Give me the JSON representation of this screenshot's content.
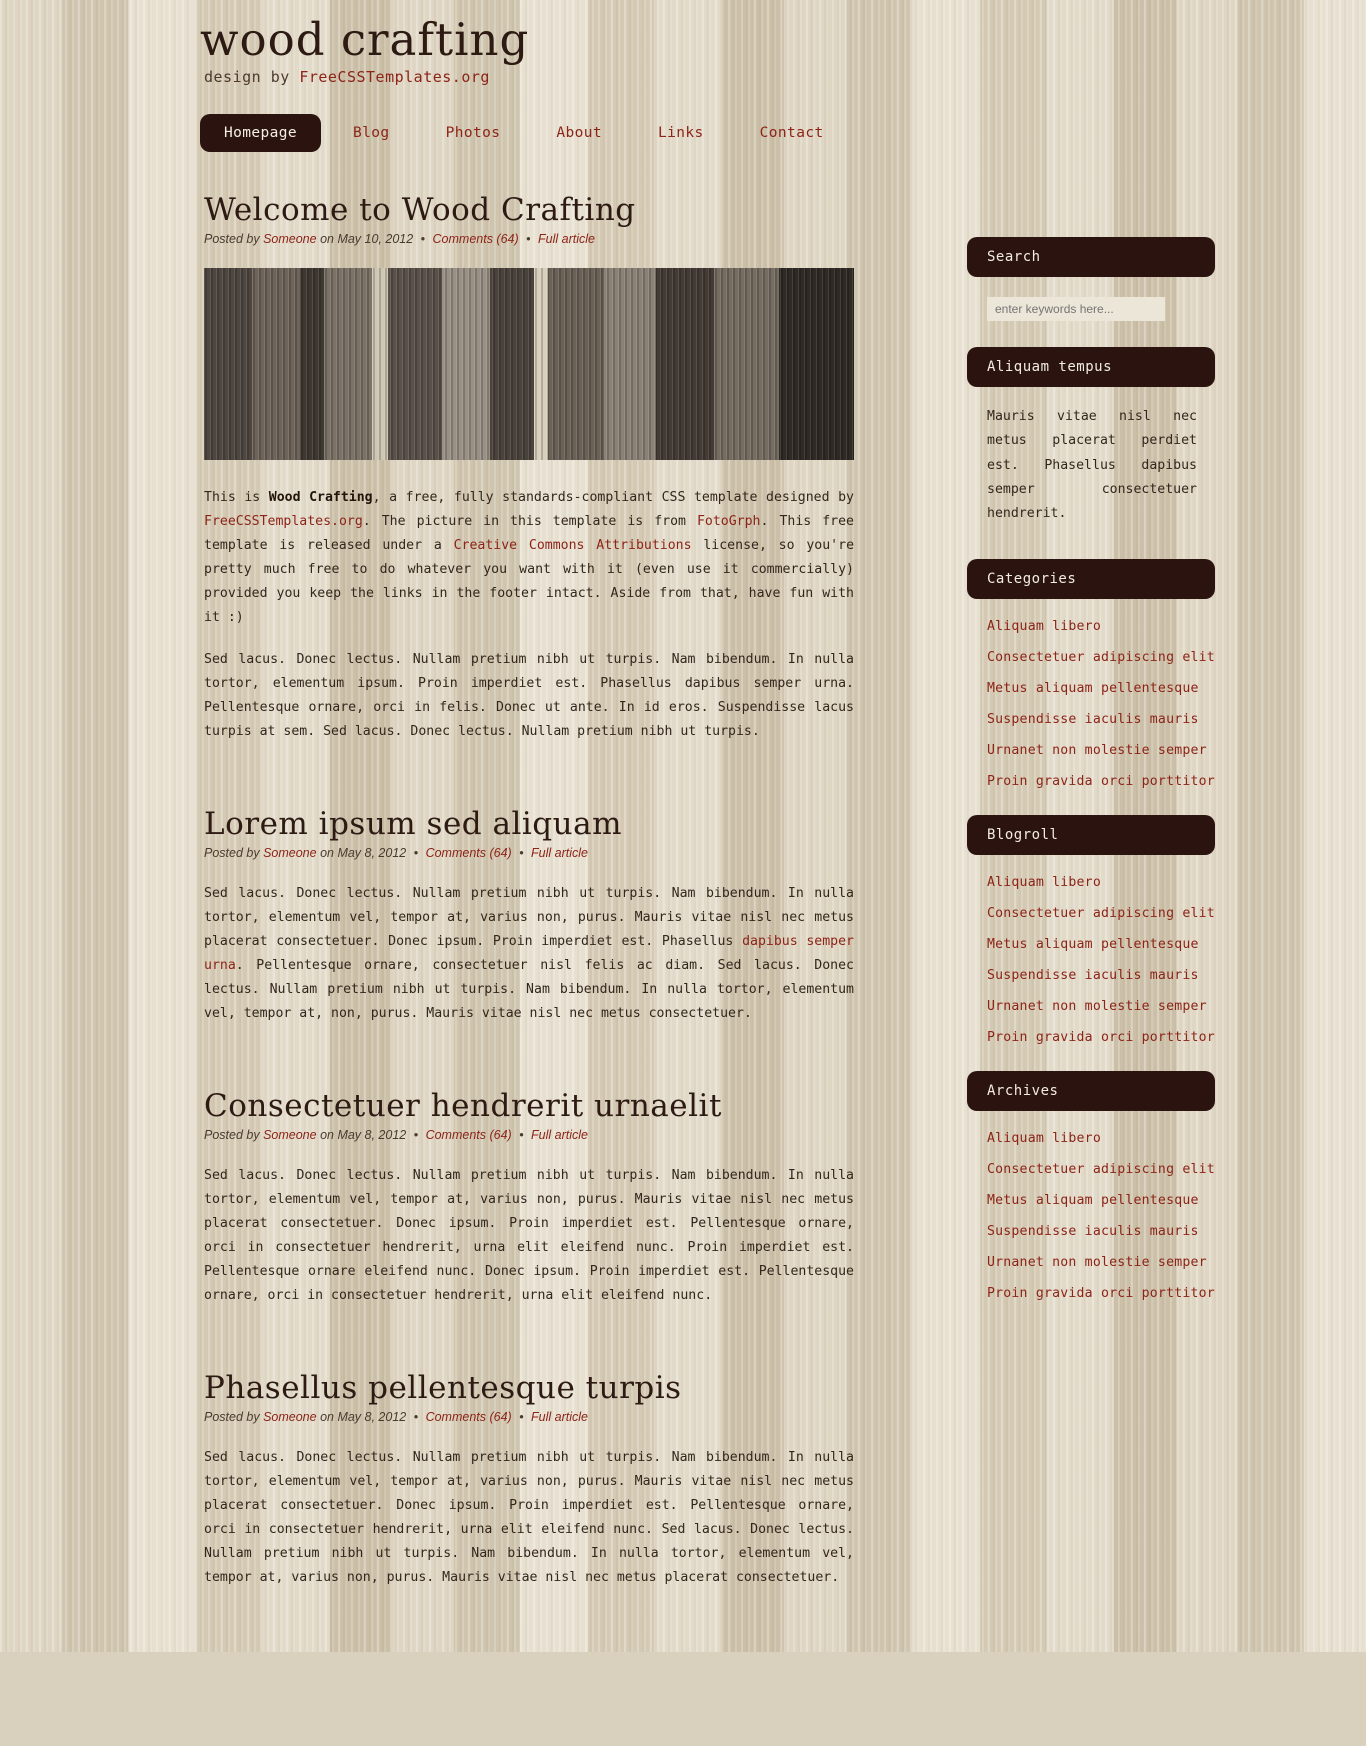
{
  "site": {
    "title": "wood crafting",
    "tagline_prefix": "design by ",
    "tagline_link": "FreeCSSTemplates.org"
  },
  "menu": {
    "items": [
      {
        "label": "Homepage",
        "active": true
      },
      {
        "label": "Blog",
        "active": false
      },
      {
        "label": "Photos",
        "active": false
      },
      {
        "label": "About",
        "active": false
      },
      {
        "label": "Links",
        "active": false
      },
      {
        "label": "Contact",
        "active": false
      }
    ]
  },
  "posts": [
    {
      "title": "Welcome to Wood Crafting",
      "meta": {
        "posted_by_prefix": "Posted by ",
        "author": "Someone",
        "date": " on May 10, 2012",
        "comments": "Comments (64)",
        "full_article": "Full article"
      },
      "has_image": true,
      "image_name": "wood-planks-photo",
      "paragraphs": [
        {
          "segments": [
            {
              "text": "This is ",
              "type": "text"
            },
            {
              "text": "Wood Crafting",
              "type": "bold"
            },
            {
              "text": ", a free, fully standards-compliant CSS template designed by ",
              "type": "text"
            },
            {
              "text": "FreeCSSTemplates.org",
              "type": "link"
            },
            {
              "text": ". The picture in this template is from ",
              "type": "text"
            },
            {
              "text": "FotoGrph",
              "type": "link"
            },
            {
              "text": ". This free template is released under a ",
              "type": "text"
            },
            {
              "text": "Creative Commons Attributions",
              "type": "link"
            },
            {
              "text": " license, so you're pretty much free to do whatever you want with it (even use it commercially) provided you keep the links in the footer intact. Aside from that, have fun with it :)",
              "type": "text"
            }
          ]
        },
        {
          "segments": [
            {
              "text": "Sed lacus. Donec lectus. Nullam pretium nibh ut turpis. Nam bibendum. In nulla tortor, elementum ipsum. Proin imperdiet est. Phasellus dapibus semper urna. Pellentesque ornare, orci in felis. Donec ut ante. In id eros. Suspendisse lacus turpis at sem. Sed lacus. Donec lectus. Nullam pretium nibh ut turpis.",
              "type": "text"
            }
          ]
        }
      ]
    },
    {
      "title": "Lorem ipsum sed aliquam",
      "meta": {
        "posted_by_prefix": "Posted by ",
        "author": "Someone",
        "date": " on May 8, 2012",
        "comments": "Comments (64)",
        "full_article": "Full article"
      },
      "has_image": false,
      "paragraphs": [
        {
          "segments": [
            {
              "text": "Sed lacus. Donec lectus. Nullam pretium nibh ut turpis. Nam bibendum. In nulla tortor, elementum vel, tempor at, varius non, purus. Mauris vitae nisl nec metus placerat consectetuer. Donec ipsum. Proin imperdiet est. Phasellus ",
              "type": "text"
            },
            {
              "text": "dapibus semper urna",
              "type": "link"
            },
            {
              "text": ". Pellentesque ornare, consectetuer nisl felis ac diam. Sed lacus. Donec lectus. Nullam pretium nibh ut turpis. Nam bibendum. In nulla tortor, elementum vel, tempor at, non, purus. Mauris vitae nisl nec metus consectetuer.",
              "type": "text"
            }
          ]
        }
      ]
    },
    {
      "title": "Consectetuer hendrerit urnaelit",
      "meta": {
        "posted_by_prefix": "Posted by ",
        "author": "Someone",
        "date": " on May 8, 2012",
        "comments": "Comments (64)",
        "full_article": "Full article"
      },
      "has_image": false,
      "paragraphs": [
        {
          "segments": [
            {
              "text": "Sed lacus. Donec lectus. Nullam pretium nibh ut turpis. Nam bibendum. In nulla tortor, elementum vel, tempor at, varius non, purus. Mauris vitae nisl nec metus placerat consectetuer. Donec ipsum. Proin imperdiet est. Pellentesque ornare, orci in consectetuer hendrerit, urna elit eleifend nunc. Proin imperdiet est. Pellentesque ornare eleifend nunc. Donec ipsum. Proin imperdiet est. Pellentesque ornare, orci in consectetuer hendrerit, urna elit eleifend nunc.",
              "type": "text"
            }
          ]
        }
      ]
    },
    {
      "title": "Phasellus pellentesque turpis",
      "meta": {
        "posted_by_prefix": "Posted by ",
        "author": "Someone",
        "date": " on May 8, 2012",
        "comments": "Comments (64)",
        "full_article": "Full article"
      },
      "has_image": false,
      "paragraphs": [
        {
          "segments": [
            {
              "text": "Sed lacus. Donec lectus. Nullam pretium nibh ut turpis. Nam bibendum. In nulla tortor, elementum vel, tempor at, varius non, purus. Mauris vitae nisl nec metus placerat consectetuer. Donec ipsum. Proin imperdiet est. Pellentesque ornare, orci in consectetuer hendrerit, urna elit eleifend nunc. Sed lacus. Donec lectus. Nullam pretium nibh ut turpis. Nam bibendum. In nulla tortor, elementum vel, tempor at, varius non, purus. Mauris vitae nisl nec metus placerat consectetuer.",
              "type": "text"
            }
          ]
        }
      ]
    }
  ],
  "sidebar": {
    "search": {
      "heading": "Search",
      "placeholder": "enter keywords here..."
    },
    "aliquam": {
      "heading": "Aliquam tempus",
      "text": "Mauris vitae nisl nec metus placerat perdiet est. Phasellus dapibus semper consectetuer hendrerit."
    },
    "categories": {
      "heading": "Categories",
      "items": [
        "Aliquam libero",
        "Consectetuer adipiscing elit",
        "Metus aliquam pellentesque",
        "Suspendisse iaculis mauris",
        "Urnanet non molestie semper",
        "Proin gravida orci porttitor"
      ]
    },
    "blogroll": {
      "heading": "Blogroll",
      "items": [
        "Aliquam libero",
        "Consectetuer adipiscing elit",
        "Metus aliquam pellentesque",
        "Suspendisse iaculis mauris",
        "Urnanet non molestie semper",
        "Proin gravida orci porttitor"
      ]
    },
    "archives": {
      "heading": "Archives",
      "items": [
        "Aliquam libero",
        "Consectetuer adipiscing elit",
        "Metus aliquam pellentesque",
        "Suspendisse iaculis mauris",
        "Urnanet non molestie semper",
        "Proin gravida orci porttitor"
      ]
    }
  },
  "colors": {
    "dark_bar": "#2b1410",
    "link_red": "#8c2418",
    "body_text": "#33261c",
    "background": "#d6ccb8"
  }
}
